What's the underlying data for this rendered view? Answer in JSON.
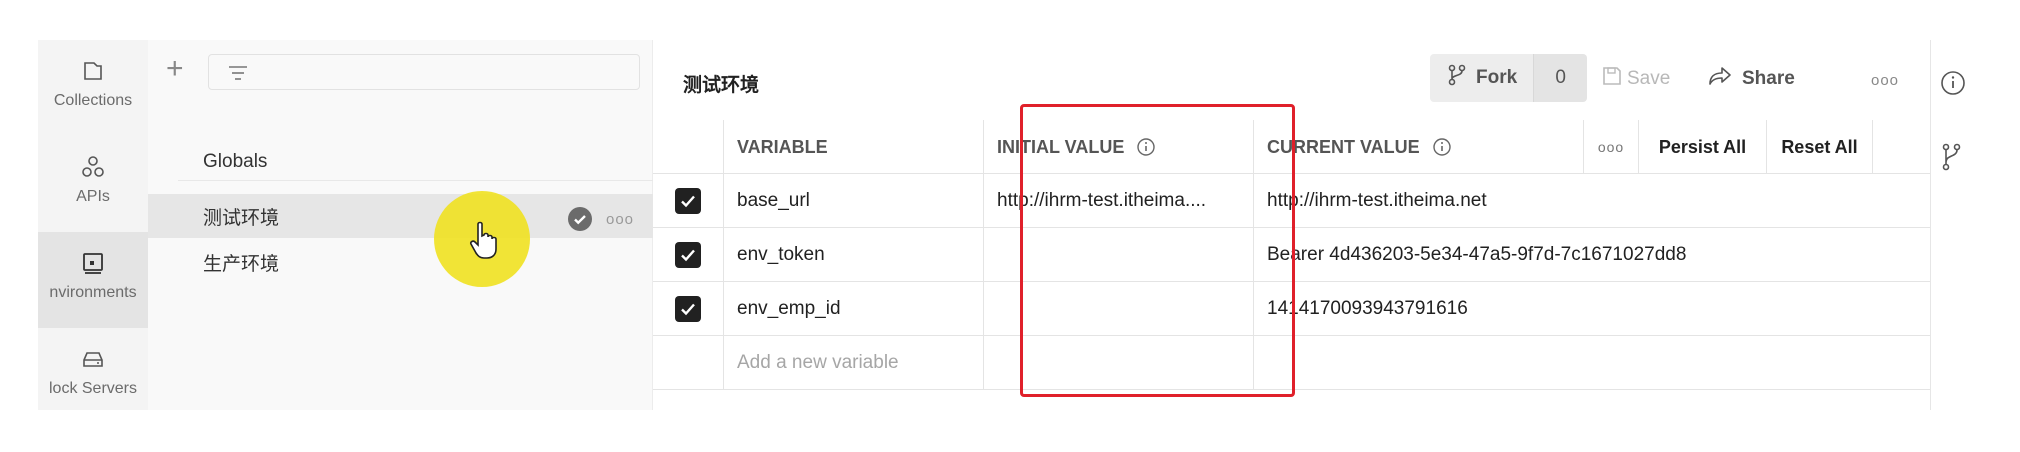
{
  "rail": {
    "items": [
      {
        "label": "Collections",
        "icon": "collection-icon"
      },
      {
        "label": "APIs",
        "icon": "apis-icon"
      },
      {
        "label": "nvironments",
        "icon": "environments-icon"
      },
      {
        "label": "lock Servers",
        "icon": "mock-server-icon"
      }
    ]
  },
  "env_list": {
    "globals_label": "Globals",
    "items": [
      {
        "name": "测试环境",
        "active": true
      },
      {
        "name": "生产环境",
        "active": false
      }
    ],
    "more_label": "ooo"
  },
  "editor": {
    "title": "测试环境",
    "fork_label": "Fork",
    "fork_count": "0",
    "save_label": "Save",
    "share_label": "Share",
    "more_label": "ooo"
  },
  "table": {
    "headers": {
      "variable": "VARIABLE",
      "initial_value": "INITIAL VALUE",
      "current_value": "CURRENT VALUE",
      "more": "ooo",
      "persist_all": "Persist All",
      "reset_all": "Reset All"
    },
    "rows": [
      {
        "checked": true,
        "variable": "base_url",
        "initial_value": "http://ihrm-test.itheima....",
        "current_value": "http://ihrm-test.itheima.net"
      },
      {
        "checked": true,
        "variable": "env_token",
        "initial_value": "",
        "current_value": "Bearer 4d436203-5e34-47a5-9f7d-7c1671027dd8"
      },
      {
        "checked": true,
        "variable": "env_emp_id",
        "initial_value": "",
        "current_value": "1414170093943791616"
      }
    ],
    "add_placeholder": "Add a new variable"
  },
  "colors": {
    "highlight_box": "#e0202a",
    "cursor_highlight": "#f0e114",
    "checkbox": "#212121"
  }
}
